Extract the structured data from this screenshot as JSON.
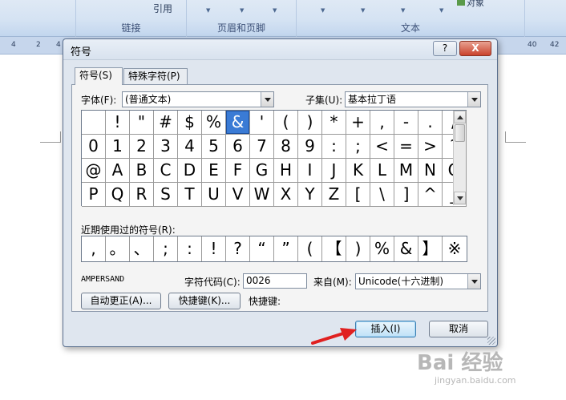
{
  "ribbon": {
    "items": [
      "引用",
      "对象"
    ],
    "groups": [
      "链接",
      "页眉和页脚",
      "文本"
    ]
  },
  "ruler": {
    "left_numbers": [
      "4",
      "2",
      "4"
    ],
    "right_numbers": [
      "40",
      "42"
    ]
  },
  "dialog": {
    "title": "符号",
    "help": "?",
    "close": "X",
    "tabs": [
      "符号(S)",
      "特殊字符(P)"
    ],
    "font_label": "字体(F):",
    "font_value": "(普通文本)",
    "subset_label": "子集(U):",
    "subset_value": "基本拉丁语",
    "symbol_rows": [
      [
        "",
        "!",
        "\"",
        "#",
        "$",
        "%",
        "&",
        "'",
        "(",
        ")",
        "*",
        "+",
        ",",
        "-",
        ".",
        "/"
      ],
      [
        "0",
        "1",
        "2",
        "3",
        "4",
        "5",
        "6",
        "7",
        "8",
        "9",
        ":",
        ";",
        "<",
        "=",
        ">",
        "?"
      ],
      [
        "@",
        "A",
        "B",
        "C",
        "D",
        "E",
        "F",
        "G",
        "H",
        "I",
        "J",
        "K",
        "L",
        "M",
        "N",
        "O"
      ],
      [
        "P",
        "Q",
        "R",
        "S",
        "T",
        "U",
        "V",
        "W",
        "X",
        "Y",
        "Z",
        "[",
        "\\",
        "]",
        "^",
        "_"
      ]
    ],
    "selected_symbol": "&",
    "recent_label": "近期使用过的符号(R):",
    "recent_symbols": [
      ",",
      "。",
      "、",
      ";",
      ":",
      "!",
      "?",
      "“",
      "”",
      "(",
      "【",
      ")",
      "%",
      "&",
      "】",
      "※"
    ],
    "char_name": "AMPERSAND",
    "char_code_label": "字符代码(C):",
    "char_code_value": "0026",
    "from_label": "来自(M):",
    "from_value": "Unicode(十六进制)",
    "autocorrect_button": "自动更正(A)...",
    "shortcut_button": "快捷键(K)...",
    "shortcut_label": "快捷键:",
    "insert_button": "插入(I)",
    "cancel_button": "取消"
  },
  "watermark": {
    "logo": "Bai 经验",
    "url": "jingyan.baidu.com"
  },
  "colors": {
    "selection": "#3a7bd5",
    "arrow": "#e02020",
    "dialog_bg": "#dfe6ef"
  }
}
